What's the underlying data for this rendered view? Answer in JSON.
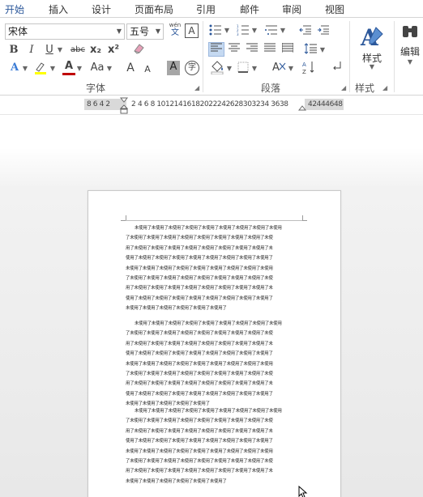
{
  "tabs": [
    {
      "label": "开始",
      "active": true
    },
    {
      "label": "插入",
      "active": false
    },
    {
      "label": "设计",
      "active": false
    },
    {
      "label": "页面布局",
      "active": false
    },
    {
      "label": "引用",
      "active": false
    },
    {
      "label": "邮件",
      "active": false
    },
    {
      "label": "审阅",
      "active": false
    },
    {
      "label": "视图",
      "active": false
    }
  ],
  "font_group": {
    "label": "字体",
    "font_name": "宋体",
    "font_size": "五号",
    "phonetic_top": "wén",
    "phonetic_bottom": "文",
    "charborder": "A",
    "bold": "B",
    "italic": "I",
    "underline": "U",
    "strike": "abc",
    "subscript": "x₂",
    "superscript": "x²",
    "texteffect": "A",
    "fontcolor": "A",
    "changecase": "Aa",
    "grow": "A",
    "shrink": "A",
    "shading": "A",
    "enclose": "字"
  },
  "paragraph_group": {
    "label": "段落"
  },
  "styles_group": {
    "label": "样式",
    "button": "样式"
  },
  "editing_group": {
    "button": "编辑"
  },
  "ruler": {
    "left_numbers": "8 6 4 2",
    "middle_numbers": "4 6 8 10121416182022242628303234 3638",
    "right_numbers": "42444648",
    "first_mark": "2"
  },
  "document": {
    "paragraphs": [
      {
        "lines": [
          "未使用了未使用了未使用了未使用了未使用了未使用了未使用了未使用了未使用",
          "了未使用了未使用了未使用了未使用了未使用了未使用了未使用了未使用了未使",
          "用了未使用了未使用了未使用了未使用了未使用了未使用了未使用了未使用了未",
          "使用了未使用了未使用了未使用了未使用了未使用了未使用了未使用了未使用了",
          "未使用了未使用了未使用了未使用了未使用了未使用了未使用了未使用了未使用",
          "了未使用了未使用了未使用了未使用了未使用了未使用了未使用了未使用了未使",
          "用了未使用了未使用了未使用了未使用了未使用了未使用了未使用了未使用了未",
          "使用了未使用了未使用了未使用了未使用了未使用了未使用了未使用了未使用了",
          "未使用了未使用了未使用了未使用了未使用了未使用了"
        ]
      },
      {
        "lines": [
          "未使用了未使用了未使用了未使用了未使用了未使用了未使用了未使用了未使用",
          "了未使用了未使用了未使用了未使用了未使用了未使用了未使用了未使用了未使",
          "用了未使用了未使用了未使用了未使用了未使用了未使用了未使用了未使用了未",
          "使用了未使用了未使用了未使用了未使用了未使用了未使用了未使用了未使用了",
          "未使用了未使用了未使用了未使用了未使用了未使用了未使用了未使用了未使用",
          "了未使用了未使用了未使用了未使用了未使用了未使用了未使用了未使用了未使",
          "用了未使用了未使用了未使用了未使用了未使用了未使用了未使用了未使用了未",
          "使用了未使用了未使用了未使用了未使用了未使用了未使用了未使用了未使用了",
          "未使用了未使用了未使用了未使用了未使用了"
        ]
      },
      {
        "lines": [
          "未使用了未使用了未使用了未使用了未使用了未使用了未使用了未使用了未使用",
          "了未使用了未使用了未使用了未使用了未使用了未使用了未使用了未使用了未使",
          "用了未使用了未使用了未使用了未使用了未使用了未使用了未使用了未使用了未",
          "使用了未使用了未使用了未使用了未使用了未使用了未使用了未使用了未使用了",
          "未使用了未使用了未使用了未使用了未使用了未使用了未使用了未使用了未使用",
          "了未使用了未使用了未使用了未使用了未使用了未使用了未使用了未使用了未使",
          "用了未使用了未使用了未使用了未使用了未使用了未使用了未使用了未使用了未",
          "未使用了未使用了未使用了未使用了未使用了未使用了"
        ]
      }
    ]
  },
  "colors": {
    "accent": "#2b579a",
    "font_color_bar": "#c00000",
    "highlight_bar": "#ffff00"
  }
}
